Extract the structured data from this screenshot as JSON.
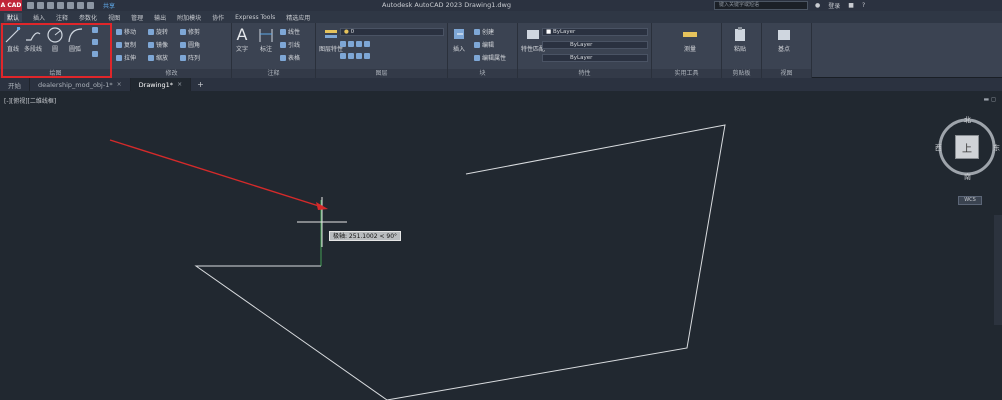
{
  "app": {
    "button_label": "A CAD",
    "title": "Autodesk AutoCAD 2023    Drawing1.dwg",
    "share_label": "共享",
    "search_placeholder": "键入关键字或短语",
    "user_label": "登录"
  },
  "menu_tabs": [
    "默认",
    "插入",
    "注释",
    "参数化",
    "视图",
    "管理",
    "输出",
    "附加模块",
    "协作",
    "Express Tools",
    "精选应用"
  ],
  "ribbon": {
    "draw": {
      "title": "绘图",
      "line_label": "直线",
      "polyline_label": "多段线",
      "circle_label": "圆",
      "arc_label": "圆弧"
    },
    "modify": {
      "title": "修改",
      "items": [
        "移动",
        "旋转",
        "修剪",
        "复制",
        "镜像",
        "圆角",
        "拉伸",
        "缩放",
        "阵列"
      ]
    },
    "annotation": {
      "title": "注释",
      "text_label": "文字",
      "dim_label": "标注",
      "items": [
        "线性",
        "引线",
        "表格"
      ]
    },
    "layers": {
      "title": "图层",
      "props_label": "图层特性",
      "current_layer": "0"
    },
    "block": {
      "title": "块",
      "insert_label": "插入",
      "items": [
        "创建",
        "编辑",
        "编辑属性"
      ]
    },
    "properties": {
      "title": "特性",
      "match_label": "特性匹配",
      "color": "ByLayer",
      "linetype": "ByLayer",
      "lineweight": "ByLayer"
    },
    "utilities": {
      "title": "实用工具",
      "measure_label": "测量"
    },
    "clipboard": {
      "title": "剪贴板",
      "paste_label": "粘贴"
    },
    "view": {
      "title": "视图",
      "base_label": "基点"
    }
  },
  "file_tabs": [
    {
      "label": "开始"
    },
    {
      "label": "dealership_mod_obj-1*"
    },
    {
      "label": "Drawing1*"
    }
  ],
  "viewport_label": "[-][俯视][二维线框]",
  "dynamic_input": "极轴: 251.1002 < 90°",
  "viewcube": {
    "north": "北",
    "south": "南",
    "west": "西",
    "east": "东",
    "face": "上",
    "wcs": "WCS"
  },
  "colors": {
    "background": "#212830",
    "highlight": "#e0262a",
    "arrow": "#d42a2a",
    "geometry": "#d9dcdf"
  }
}
